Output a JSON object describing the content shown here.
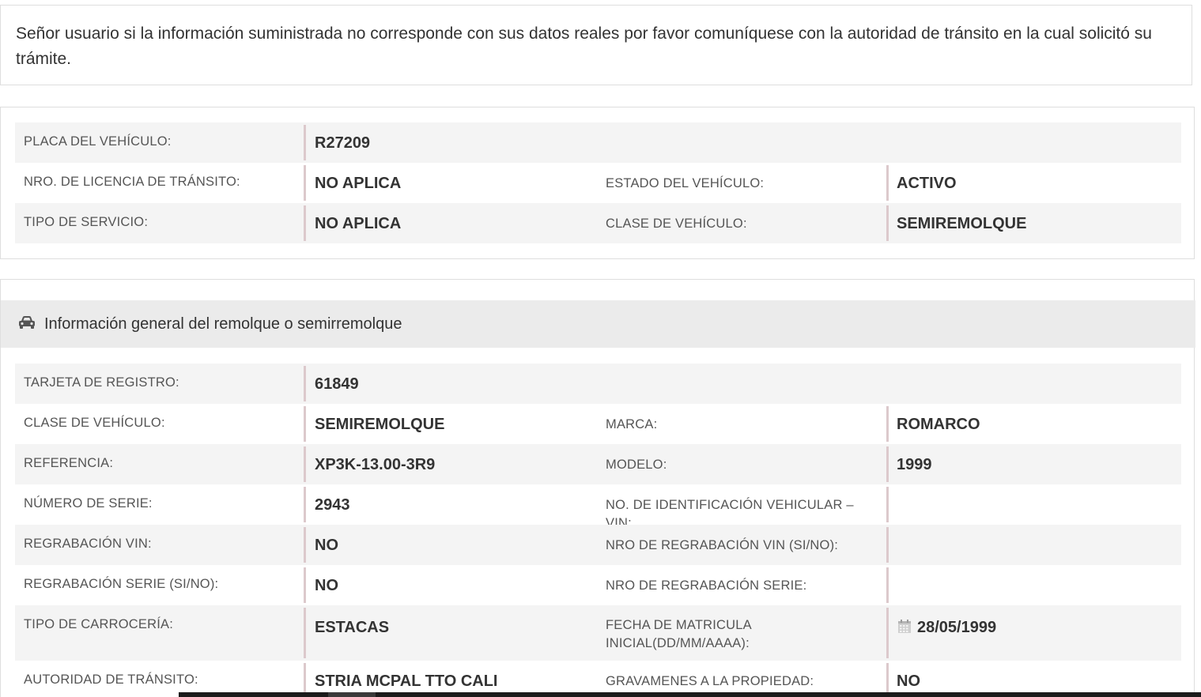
{
  "notice": {
    "text": "Señor usuario si la información suministrada no corresponde con sus datos reales por favor comuníquese con la autoridad de tránsito en la cual solicitó su trámite."
  },
  "vehicle_summary": {
    "rows": [
      {
        "label_left": "PLACA DEL VEHÍCULO:",
        "value_left": "R27209"
      },
      {
        "label_left": "NRO. DE LICENCIA DE TRÁNSITO:",
        "value_left": "NO APLICA",
        "label_right": "ESTADO DEL VEHÍCULO:",
        "value_right": "ACTIVO"
      },
      {
        "label_left": "TIPO DE SERVICIO:",
        "value_left": "NO APLICA",
        "label_right": "CLASE DE VEHÍCULO:",
        "value_right": "SEMIREMOLQUE"
      }
    ]
  },
  "trailer_section": {
    "header_icon": "car-icon",
    "title": "Información general del remolque o semirremolque",
    "rows": [
      {
        "label_left": "TARJETA DE REGISTRO:",
        "value_left": "61849"
      },
      {
        "label_left": "CLASE DE VEHÍCULO:",
        "value_left": "SEMIREMOLQUE",
        "label_right": "MARCA:",
        "value_right": "ROMARCO"
      },
      {
        "label_left": "REFERENCIA:",
        "value_left": "XP3K-13.00-3R9",
        "label_right": "MODELO:",
        "value_right": "1999"
      },
      {
        "label_left": "NÚMERO DE SERIE:",
        "value_left": "2943",
        "label_right": "NO. DE IDENTIFICACIÓN VEHICULAR – VIN:",
        "value_right": ""
      },
      {
        "label_left": "REGRABACIÓN VIN:",
        "value_left": "NO",
        "label_right": "NRO DE REGRABACIÓN VIN (SI/NO):",
        "value_right": ""
      },
      {
        "label_left": "REGRABACIÓN SERIE (SI/NO):",
        "value_left": "NO",
        "label_right": "NRO DE REGRABACIÓN SERIE:",
        "value_right": ""
      },
      {
        "label_left": "TIPO DE CARROCERÍA:",
        "value_left": "ESTACAS",
        "label_right": "FECHA DE MATRICULA INICIAL(DD/MM/AAAA):",
        "value_right": "28/05/1999",
        "value_right_icon": "calendar-icon"
      },
      {
        "label_left": "AUTORIDAD DE TRÁNSITO:",
        "value_left": "STRIA MCPAL TTO CALI",
        "label_right": "GRAVAMENES A LA PROPIEDAD:",
        "value_right": "NO"
      }
    ]
  },
  "colors": {
    "row_stripe": "#f4f4f4",
    "header_bg": "#ebebeb",
    "separator": "#dcc9cc",
    "border": "#dedede"
  }
}
